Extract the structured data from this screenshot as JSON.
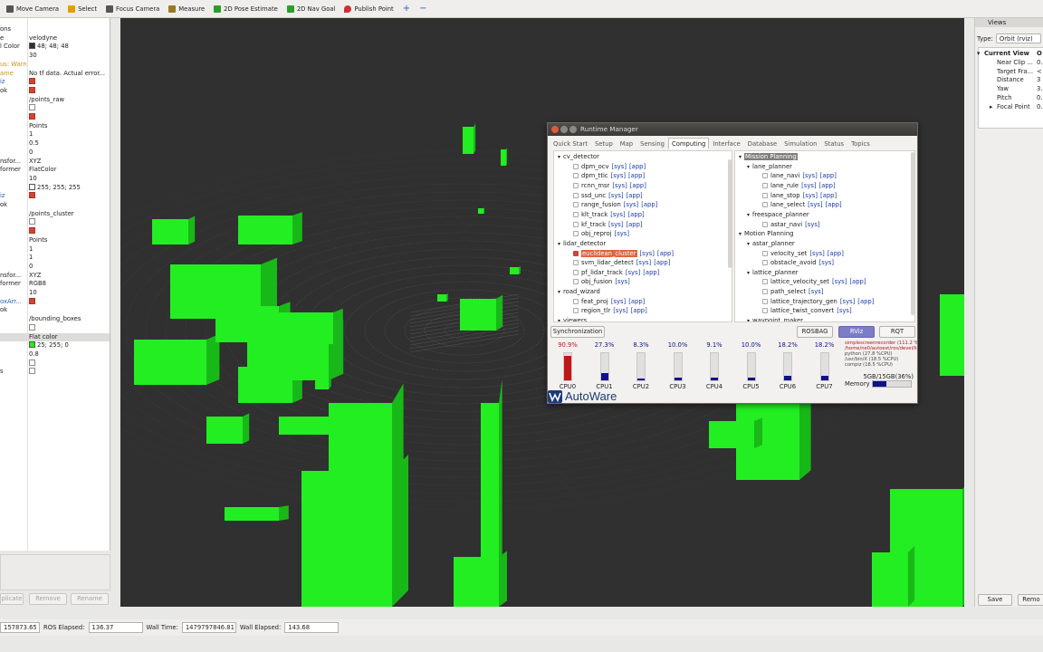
{
  "toolbar": {
    "items": [
      {
        "label": "Move Camera",
        "icon": "move-camera-icon",
        "color": "#555555"
      },
      {
        "label": "Select",
        "icon": "select-icon",
        "color": "#e2a000"
      },
      {
        "label": "Focus Camera",
        "icon": "focus-camera-icon",
        "color": "#555555"
      },
      {
        "label": "Measure",
        "icon": "measure-icon",
        "color": "#9a7a20"
      },
      {
        "label": "2D Pose Estimate",
        "icon": "pose-estimate-icon",
        "color": "#2aa02a"
      },
      {
        "label": "2D Nav Goal",
        "icon": "nav-goal-icon",
        "color": "#2aa02a"
      },
      {
        "label": "Publish Point",
        "icon": "publish-point-icon",
        "color": "#d03030"
      }
    ],
    "plus": "+",
    "minus": "−",
    "arrow": "▾"
  },
  "displays": {
    "rows": [
      {
        "k": "ons",
        "v": ""
      },
      {
        "k": "e",
        "v": "velodyne"
      },
      {
        "k": "l Color",
        "v": "48; 48; 48",
        "sw": "#303030"
      },
      {
        "k": "",
        "v": "30"
      },
      {
        "k": "us: Warn",
        "v": "",
        "cls": "warn"
      },
      {
        "k": "ame",
        "v": "No tf data.  Actual error...",
        "cls": "warn"
      },
      {
        "k": "iz",
        "v": "",
        "cb": true,
        "cls": "blue"
      },
      {
        "k": "ok",
        "v": "",
        "cb": true
      },
      {
        "k": "",
        "v": "/points_raw"
      },
      {
        "k": "",
        "v": "",
        "cb": false
      },
      {
        "k": "",
        "v": "",
        "cb": true
      },
      {
        "k": "",
        "v": "Points"
      },
      {
        "k": "",
        "v": "1"
      },
      {
        "k": "",
        "v": "0.5"
      },
      {
        "k": "",
        "v": "0"
      },
      {
        "k": "nsfor...",
        "v": "XYZ"
      },
      {
        "k": "former",
        "v": "FlatColor"
      },
      {
        "k": "",
        "v": "10"
      },
      {
        "k": "",
        "v": "255; 255; 255",
        "sw": "#ffffff"
      },
      {
        "k": "iz",
        "v": "",
        "cb": true,
        "cls": "blue"
      },
      {
        "k": "ok",
        "v": ""
      },
      {
        "k": "",
        "v": "/points_cluster"
      },
      {
        "k": "",
        "v": "",
        "cb": false
      },
      {
        "k": "",
        "v": "",
        "cb": true
      },
      {
        "k": "",
        "v": "Points"
      },
      {
        "k": "",
        "v": "1"
      },
      {
        "k": "",
        "v": "1"
      },
      {
        "k": "",
        "v": "0"
      },
      {
        "k": "nsfor...",
        "v": "XYZ"
      },
      {
        "k": "former",
        "v": "RGB8"
      },
      {
        "k": "",
        "v": "10"
      },
      {
        "k": "oxArr...",
        "v": "",
        "cb": true,
        "cls": "blue"
      },
      {
        "k": "ok",
        "v": ""
      },
      {
        "k": "",
        "v": "/bounding_boxes"
      },
      {
        "k": "",
        "v": "",
        "cb": false
      },
      {
        "k": "",
        "v": "Flat color",
        "cls": "hl"
      },
      {
        "k": "",
        "v": "25; 255; 0",
        "sw": "#19ff00"
      },
      {
        "k": "",
        "v": "0.8"
      },
      {
        "k": "",
        "v": "",
        "cb": false
      },
      {
        "k": "s",
        "v": "",
        "cb": false
      }
    ],
    "buttons": [
      "plicate",
      "Remove",
      "Rename"
    ]
  },
  "views": {
    "title": "Views",
    "type_label": "Type:",
    "type_value": "Orbit (rviz)",
    "tree": [
      {
        "t": "Current View",
        "bold": true
      },
      {
        "t": "Near Clip ..."
      },
      {
        "t": "Target Fra..."
      },
      {
        "t": "Distance"
      },
      {
        "t": "Yaw"
      },
      {
        "t": "Pitch"
      },
      {
        "t": "Focal Point",
        "arrow": true
      }
    ],
    "col2": [
      "O",
      "0.",
      "<",
      "3",
      "3.",
      "0.",
      "0."
    ],
    "save": "Save",
    "remove": "Remo"
  },
  "status": {
    "ros_time_value": "157873.65",
    "ros_elapsed_label": "ROS Elapsed:",
    "ros_elapsed": "136.37",
    "wall_time_label": "Wall Time:",
    "wall_time": "1479797846.81",
    "wall_elapsed_label": "Wall Elapsed:",
    "wall_elapsed": "143.68"
  },
  "rm": {
    "title": "Runtime Manager",
    "tabs": [
      "Quick Start",
      "Setup",
      "Map",
      "Sensing",
      "Computing",
      "Interface",
      "Database",
      "Simulation",
      "Status",
      "Topics"
    ],
    "active_tab": 4,
    "left_tree": [
      {
        "label": "cv_detector",
        "lvl": 0,
        "exp": true
      },
      {
        "label": "dpm_ocv",
        "lvl": 1,
        "cb": false,
        "links": true
      },
      {
        "label": "dpm_ttic",
        "lvl": 1,
        "cb": false,
        "links": true
      },
      {
        "label": "rcnn_msr",
        "lvl": 1,
        "cb": false,
        "links": true
      },
      {
        "label": "ssd_unc",
        "lvl": 1,
        "cb": false,
        "links": true
      },
      {
        "label": "range_fusion",
        "lvl": 1,
        "cb": false,
        "links": true
      },
      {
        "label": "klt_track",
        "lvl": 1,
        "cb": false,
        "links": true
      },
      {
        "label": "kf_track",
        "lvl": 1,
        "cb": false,
        "links": true
      },
      {
        "label": "obj_reproj",
        "lvl": 1,
        "cb": false,
        "sysonly": true
      },
      {
        "label": "lidar_detector",
        "lvl": 0,
        "exp": true
      },
      {
        "label": "euclidean_cluster",
        "lvl": 1,
        "cb": true,
        "links": true,
        "sel": true
      },
      {
        "label": "svm_lidar_detect",
        "lvl": 1,
        "cb": false,
        "links": true
      },
      {
        "label": "pf_lidar_track",
        "lvl": 1,
        "cb": false,
        "links": true
      },
      {
        "label": "obj_fusion",
        "lvl": 1,
        "cb": false,
        "sysonly": true
      },
      {
        "label": "road_wizard",
        "lvl": 0,
        "exp": true
      },
      {
        "label": "feat_proj",
        "lvl": 1,
        "cb": false,
        "links": true
      },
      {
        "label": "region_tlr",
        "lvl": 1,
        "cb": false,
        "links": true
      },
      {
        "label": "viewers",
        "lvl": 0,
        "exp": true
      }
    ],
    "right_tree": [
      {
        "label": "Mission Planning",
        "lvl": 0,
        "exp": true,
        "selg": true
      },
      {
        "label": "lane_planner",
        "lvl": 1,
        "exp": true
      },
      {
        "label": "lane_navi",
        "lvl": 2,
        "cb": false,
        "links": true
      },
      {
        "label": "lane_rule",
        "lvl": 2,
        "cb": false,
        "links": true
      },
      {
        "label": "lane_stop",
        "lvl": 2,
        "cb": false,
        "links": true
      },
      {
        "label": "lane_select",
        "lvl": 2,
        "cb": false,
        "links": true
      },
      {
        "label": "freespace_planner",
        "lvl": 1,
        "exp": true
      },
      {
        "label": "astar_navi",
        "lvl": 2,
        "cb": false,
        "sysonly": true
      },
      {
        "label": "Motion Planning",
        "lvl": 0,
        "exp": true
      },
      {
        "label": "astar_planner",
        "lvl": 1,
        "exp": true
      },
      {
        "label": "velocity_set",
        "lvl": 2,
        "cb": false,
        "links": true
      },
      {
        "label": "obstacle_avoid",
        "lvl": 2,
        "cb": false,
        "sysonly": true
      },
      {
        "label": "lattice_planner",
        "lvl": 1,
        "exp": true
      },
      {
        "label": "lattice_velocity_set",
        "lvl": 2,
        "cb": false,
        "links": true
      },
      {
        "label": "path_select",
        "lvl": 2,
        "cb": false,
        "sysonly": true
      },
      {
        "label": "lattice_trajectory_gen",
        "lvl": 2,
        "cb": false,
        "links": true
      },
      {
        "label": "lattice_twist_convert",
        "lvl": 2,
        "cb": false,
        "sysonly": true
      },
      {
        "label": "waypoint_maker",
        "lvl": 1,
        "exp": true
      }
    ],
    "sys": "[sys]",
    "app": "[app]",
    "buttons": {
      "sync": "Synchronization",
      "rosbag": "ROSBAG",
      "rviz": "RViz",
      "rqt": "RQT"
    },
    "cpus": [
      {
        "pct": "90.9%",
        "v": 0.909,
        "label": "CPU0",
        "color": "#c01818"
      },
      {
        "pct": "27.3%",
        "v": 0.273,
        "label": "CPU1",
        "color": "#10108c"
      },
      {
        "pct": "8.3%",
        "v": 0.083,
        "label": "CPU2",
        "color": "#10108c"
      },
      {
        "pct": "10.0%",
        "v": 0.1,
        "label": "CPU3",
        "color": "#10108c"
      },
      {
        "pct": "9.1%",
        "v": 0.091,
        "label": "CPU4",
        "color": "#10108c"
      },
      {
        "pct": "10.0%",
        "v": 0.1,
        "label": "CPU5",
        "color": "#10108c"
      },
      {
        "pct": "18.2%",
        "v": 0.182,
        "label": "CPU6",
        "color": "#10108c"
      },
      {
        "pct": "18.2%",
        "v": 0.182,
        "label": "CPU7",
        "color": "#10108c"
      }
    ],
    "proc": [
      "simplescreenrecorder (111.2 %CPU)",
      "/home/ne0/autoest/ros/devel/lib/ ...",
      "python (27.8 %CPU)",
      "/usr/bin/X (18.5 %CPU)",
      "compiz (18.5 %CPU)"
    ],
    "memory": {
      "text": "5GB/15GB(36%)",
      "label": "Memory",
      "value": 0.36
    },
    "logo": "AutoWare"
  },
  "colors": {
    "box": "#22ee22",
    "bg": "#303030",
    "accent": "#7d7cc8"
  }
}
